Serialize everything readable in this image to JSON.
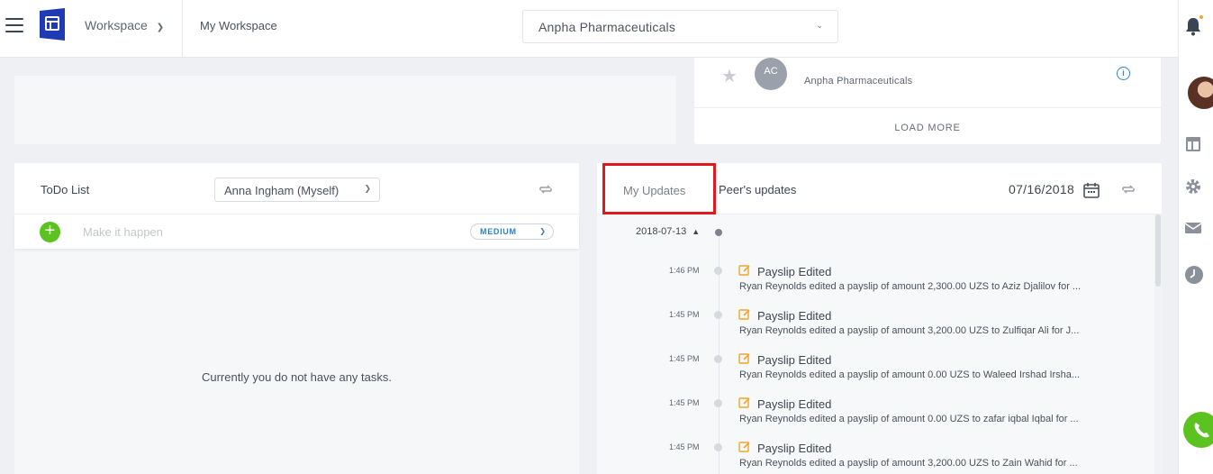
{
  "header": {
    "workspace_select": "Workspace",
    "workspace_title": "My Workspace",
    "company": "Anpha Pharmaceuticals"
  },
  "top_right_panel": {
    "org_initials": "AC",
    "org_name": "Anpha Pharmaceuticals",
    "info_glyph": "i",
    "load_more": "LOAD MORE"
  },
  "todo": {
    "title": "ToDo List",
    "assignee": "Anna Ingham (Myself)",
    "input_placeholder": "Make it happen",
    "priority": "MEDIUM",
    "empty_message": "Currently you do not have any tasks."
  },
  "updates": {
    "tab_my": "My Updates",
    "tab_peers": "Peer's updates",
    "date": "07/16/2018",
    "group_date": "2018-07-13",
    "entries": [
      {
        "time": "1:46 PM",
        "title": "Payslip Edited",
        "desc": "Ryan Reynolds edited a payslip of amount 2,300.00 UZS to Aziz Djalilov for ..."
      },
      {
        "time": "1:45 PM",
        "title": "Payslip Edited",
        "desc": "Ryan Reynolds edited a payslip of amount 3,200.00 UZS to Zulfiqar Ali for J..."
      },
      {
        "time": "1:45 PM",
        "title": "Payslip Edited",
        "desc": "Ryan Reynolds edited a payslip of amount 0.00 UZS to Waleed Irshad Irsha..."
      },
      {
        "time": "1:45 PM",
        "title": "Payslip Edited",
        "desc": "Ryan Reynolds edited a payslip of amount 0.00 UZS to zafar iqbal Iqbal for ..."
      },
      {
        "time": "1:45 PM",
        "title": "Payslip Edited",
        "desc": "Ryan Reynolds edited a payslip of amount 3,200.00 UZS to Zain Wahid for ..."
      }
    ]
  },
  "icons": {
    "menu": "hamburger-icon",
    "logo": "workspace-logo",
    "bell": "bell-icon",
    "dashboard": "dashboard-icon",
    "settings": "gear-icon",
    "mail": "mail-icon",
    "clock": "clock-icon",
    "phone": "phone-icon",
    "refresh": "refresh-icon",
    "calendar": "calendar-icon",
    "edit": "edit-icon",
    "star": "star-icon"
  },
  "colors": {
    "accent_green": "#5cc21f",
    "brand_blue": "#1f3bb3",
    "highlight_red": "#e0191f",
    "link_blue": "#2f7fc2"
  }
}
